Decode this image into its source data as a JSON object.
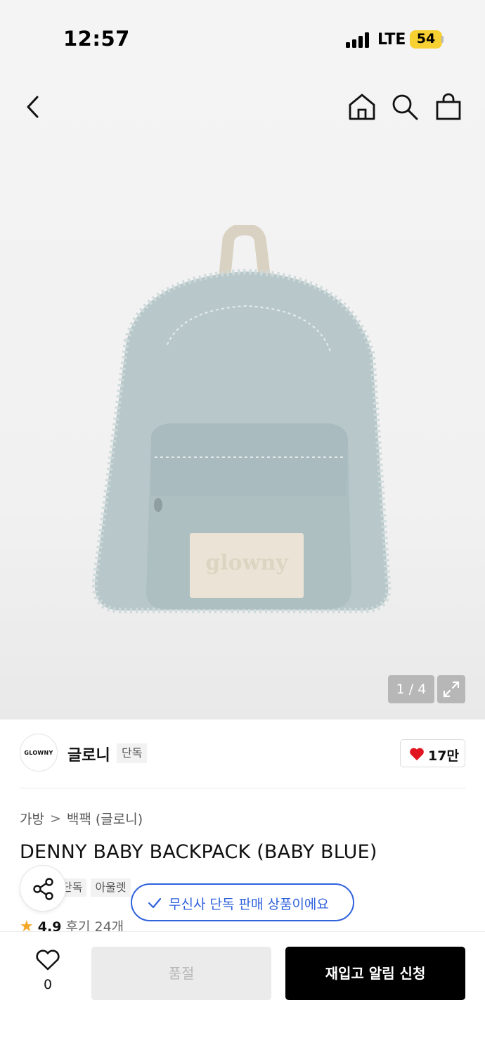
{
  "status_bar": {
    "time": "12:57",
    "network": "LTE",
    "battery": "54"
  },
  "nav": {
    "icons": [
      "back-icon",
      "home-icon",
      "search-icon",
      "shopping-bag-icon"
    ]
  },
  "gallery": {
    "counter": "1 / 4",
    "image_subject": "denim backpack",
    "logo_patch": "glowny"
  },
  "brand": {
    "logo_text": "GLOWNY",
    "name": "글로니",
    "tag": "단독",
    "likes": "17만"
  },
  "breadcrumb": {
    "category": "가방",
    "separator": ">",
    "subcategory": "백팩 (글로니)"
  },
  "product": {
    "title": "DENNY BABY BACKPACK (BABY BLUE)",
    "tags": [
      "단독",
      "아울렛"
    ]
  },
  "tooltip": {
    "text": "무신사 단독 판매 상품이에요"
  },
  "rating": {
    "score": "4.9",
    "reviews": "후기 24개"
  },
  "bottom_bar": {
    "wish_count": "0",
    "soldout_label": "품절",
    "restock_label": "재입고 알림 신청"
  },
  "colors": {
    "accent_blue": "#2f62dd",
    "heart_red": "#e0151f",
    "star": "#f5a623",
    "denim": "#b7c6c8"
  }
}
